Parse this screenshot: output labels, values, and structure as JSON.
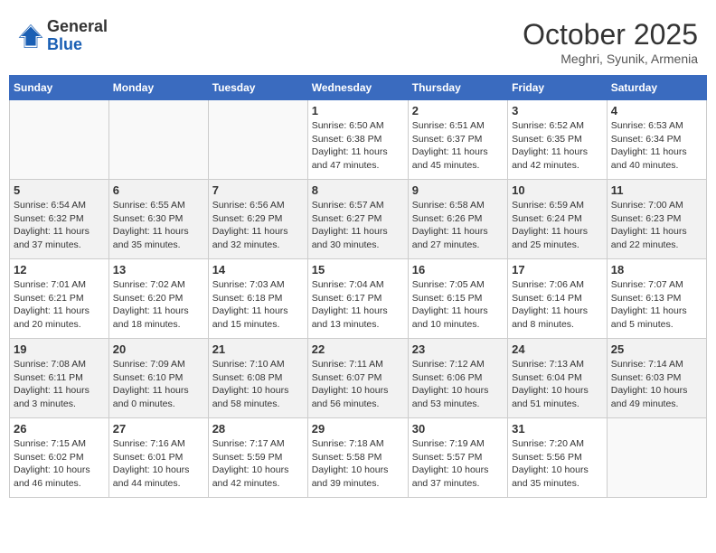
{
  "header": {
    "logo_line1": "General",
    "logo_line2": "Blue",
    "month": "October 2025",
    "location": "Meghri, Syunik, Armenia"
  },
  "weekdays": [
    "Sunday",
    "Monday",
    "Tuesday",
    "Wednesday",
    "Thursday",
    "Friday",
    "Saturday"
  ],
  "rows": [
    [
      {
        "day": "",
        "info": ""
      },
      {
        "day": "",
        "info": ""
      },
      {
        "day": "",
        "info": ""
      },
      {
        "day": "1",
        "info": "Sunrise: 6:50 AM\nSunset: 6:38 PM\nDaylight: 11 hours\nand 47 minutes."
      },
      {
        "day": "2",
        "info": "Sunrise: 6:51 AM\nSunset: 6:37 PM\nDaylight: 11 hours\nand 45 minutes."
      },
      {
        "day": "3",
        "info": "Sunrise: 6:52 AM\nSunset: 6:35 PM\nDaylight: 11 hours\nand 42 minutes."
      },
      {
        "day": "4",
        "info": "Sunrise: 6:53 AM\nSunset: 6:34 PM\nDaylight: 11 hours\nand 40 minutes."
      }
    ],
    [
      {
        "day": "5",
        "info": "Sunrise: 6:54 AM\nSunset: 6:32 PM\nDaylight: 11 hours\nand 37 minutes."
      },
      {
        "day": "6",
        "info": "Sunrise: 6:55 AM\nSunset: 6:30 PM\nDaylight: 11 hours\nand 35 minutes."
      },
      {
        "day": "7",
        "info": "Sunrise: 6:56 AM\nSunset: 6:29 PM\nDaylight: 11 hours\nand 32 minutes."
      },
      {
        "day": "8",
        "info": "Sunrise: 6:57 AM\nSunset: 6:27 PM\nDaylight: 11 hours\nand 30 minutes."
      },
      {
        "day": "9",
        "info": "Sunrise: 6:58 AM\nSunset: 6:26 PM\nDaylight: 11 hours\nand 27 minutes."
      },
      {
        "day": "10",
        "info": "Sunrise: 6:59 AM\nSunset: 6:24 PM\nDaylight: 11 hours\nand 25 minutes."
      },
      {
        "day": "11",
        "info": "Sunrise: 7:00 AM\nSunset: 6:23 PM\nDaylight: 11 hours\nand 22 minutes."
      }
    ],
    [
      {
        "day": "12",
        "info": "Sunrise: 7:01 AM\nSunset: 6:21 PM\nDaylight: 11 hours\nand 20 minutes."
      },
      {
        "day": "13",
        "info": "Sunrise: 7:02 AM\nSunset: 6:20 PM\nDaylight: 11 hours\nand 18 minutes."
      },
      {
        "day": "14",
        "info": "Sunrise: 7:03 AM\nSunset: 6:18 PM\nDaylight: 11 hours\nand 15 minutes."
      },
      {
        "day": "15",
        "info": "Sunrise: 7:04 AM\nSunset: 6:17 PM\nDaylight: 11 hours\nand 13 minutes."
      },
      {
        "day": "16",
        "info": "Sunrise: 7:05 AM\nSunset: 6:15 PM\nDaylight: 11 hours\nand 10 minutes."
      },
      {
        "day": "17",
        "info": "Sunrise: 7:06 AM\nSunset: 6:14 PM\nDaylight: 11 hours\nand 8 minutes."
      },
      {
        "day": "18",
        "info": "Sunrise: 7:07 AM\nSunset: 6:13 PM\nDaylight: 11 hours\nand 5 minutes."
      }
    ],
    [
      {
        "day": "19",
        "info": "Sunrise: 7:08 AM\nSunset: 6:11 PM\nDaylight: 11 hours\nand 3 minutes."
      },
      {
        "day": "20",
        "info": "Sunrise: 7:09 AM\nSunset: 6:10 PM\nDaylight: 11 hours\nand 0 minutes."
      },
      {
        "day": "21",
        "info": "Sunrise: 7:10 AM\nSunset: 6:08 PM\nDaylight: 10 hours\nand 58 minutes."
      },
      {
        "day": "22",
        "info": "Sunrise: 7:11 AM\nSunset: 6:07 PM\nDaylight: 10 hours\nand 56 minutes."
      },
      {
        "day": "23",
        "info": "Sunrise: 7:12 AM\nSunset: 6:06 PM\nDaylight: 10 hours\nand 53 minutes."
      },
      {
        "day": "24",
        "info": "Sunrise: 7:13 AM\nSunset: 6:04 PM\nDaylight: 10 hours\nand 51 minutes."
      },
      {
        "day": "25",
        "info": "Sunrise: 7:14 AM\nSunset: 6:03 PM\nDaylight: 10 hours\nand 49 minutes."
      }
    ],
    [
      {
        "day": "26",
        "info": "Sunrise: 7:15 AM\nSunset: 6:02 PM\nDaylight: 10 hours\nand 46 minutes."
      },
      {
        "day": "27",
        "info": "Sunrise: 7:16 AM\nSunset: 6:01 PM\nDaylight: 10 hours\nand 44 minutes."
      },
      {
        "day": "28",
        "info": "Sunrise: 7:17 AM\nSunset: 5:59 PM\nDaylight: 10 hours\nand 42 minutes."
      },
      {
        "day": "29",
        "info": "Sunrise: 7:18 AM\nSunset: 5:58 PM\nDaylight: 10 hours\nand 39 minutes."
      },
      {
        "day": "30",
        "info": "Sunrise: 7:19 AM\nSunset: 5:57 PM\nDaylight: 10 hours\nand 37 minutes."
      },
      {
        "day": "31",
        "info": "Sunrise: 7:20 AM\nSunset: 5:56 PM\nDaylight: 10 hours\nand 35 minutes."
      },
      {
        "day": "",
        "info": ""
      }
    ]
  ]
}
